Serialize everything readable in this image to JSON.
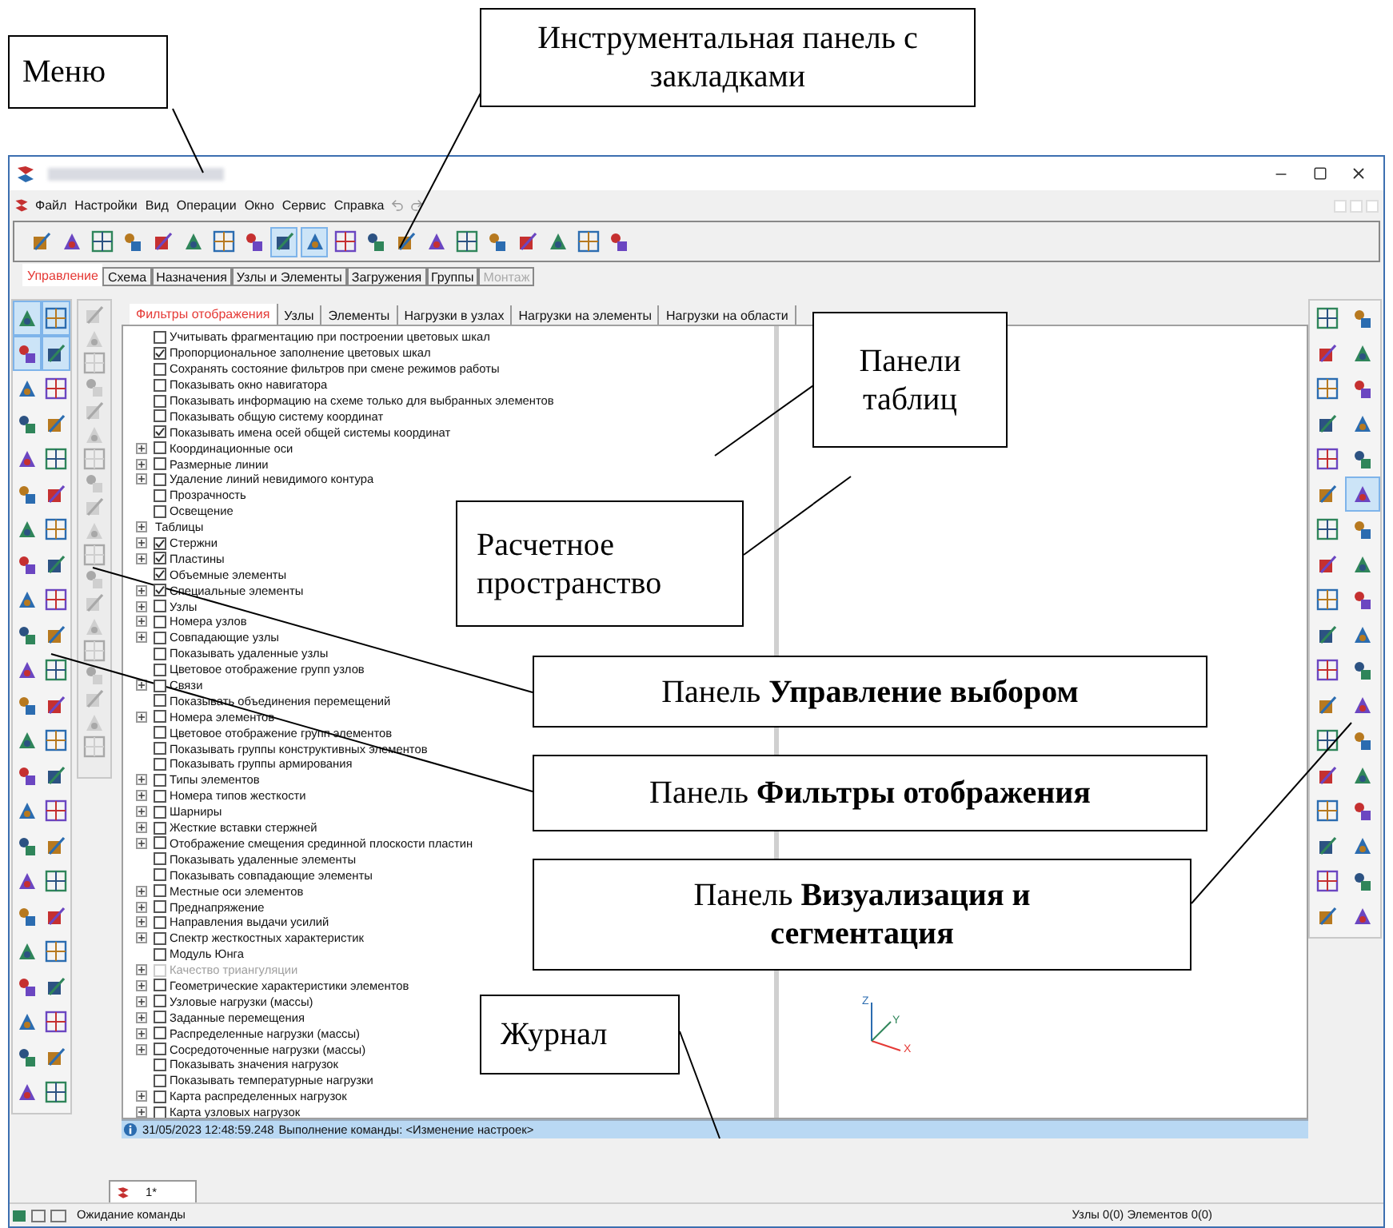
{
  "menu_bar": {
    "items": [
      "Файл",
      "Настройки",
      "Вид",
      "Операции",
      "Окно",
      "Сервис",
      "Справка"
    ]
  },
  "toolbar": {
    "buttons": [
      {
        "selected": false
      },
      {
        "selected": false
      },
      {
        "selected": false
      },
      {
        "selected": false
      },
      {
        "selected": false
      },
      {
        "selected": false
      },
      {
        "selected": false
      },
      {
        "selected": false
      },
      {
        "selected": true
      },
      {
        "selected": true
      },
      {
        "selected": false
      },
      {
        "selected": false
      },
      {
        "selected": false
      },
      {
        "selected": false
      },
      {
        "selected": false
      },
      {
        "selected": false
      },
      {
        "selected": false
      },
      {
        "selected": false
      },
      {
        "selected": false
      },
      {
        "selected": false
      }
    ]
  },
  "toolbar_tabs": [
    {
      "label": "Управление",
      "selected": true,
      "disabled": false
    },
    {
      "label": "Схема",
      "selected": false,
      "disabled": false
    },
    {
      "label": "Назначения",
      "selected": false,
      "disabled": false
    },
    {
      "label": "Узлы и Элементы",
      "selected": false,
      "disabled": false
    },
    {
      "label": "Загружения",
      "selected": false,
      "disabled": false
    },
    {
      "label": "Группы",
      "selected": false,
      "disabled": false
    },
    {
      "label": "Монтаж",
      "selected": false,
      "disabled": true
    }
  ],
  "left_toolbar": {
    "buttons": [
      {
        "selected": true
      },
      {
        "selected": true
      },
      {
        "selected": true
      },
      {
        "selected": true
      },
      {
        "selected": false
      },
      {
        "selected": false
      },
      {
        "selected": false
      },
      {
        "selected": false
      },
      {
        "selected": false
      },
      {
        "selected": false
      },
      {
        "selected": false
      },
      {
        "selected": false
      },
      {
        "selected": false
      },
      {
        "selected": false
      },
      {
        "selected": false
      },
      {
        "selected": false
      },
      {
        "selected": false
      },
      {
        "selected": false
      },
      {
        "selected": false
      },
      {
        "selected": false
      },
      {
        "selected": false
      },
      {
        "selected": false
      },
      {
        "selected": false
      },
      {
        "selected": false
      },
      {
        "selected": false
      },
      {
        "selected": false
      },
      {
        "selected": false
      },
      {
        "selected": false
      },
      {
        "selected": false
      },
      {
        "selected": false
      },
      {
        "selected": false
      },
      {
        "selected": false
      },
      {
        "selected": false
      },
      {
        "selected": false
      },
      {
        "selected": false
      },
      {
        "selected": false
      },
      {
        "selected": false
      },
      {
        "selected": false
      },
      {
        "selected": false
      },
      {
        "selected": false
      },
      {
        "selected": false
      },
      {
        "selected": false
      },
      {
        "selected": false
      },
      {
        "selected": false
      },
      {
        "selected": false
      },
      {
        "selected": false
      }
    ]
  },
  "right_toolbar": {
    "buttons": [
      {
        "selected": false
      },
      {
        "selected": false
      },
      {
        "selected": false
      },
      {
        "selected": false
      },
      {
        "selected": false
      },
      {
        "selected": false
      },
      {
        "selected": false
      },
      {
        "selected": false
      },
      {
        "selected": false
      },
      {
        "selected": false
      },
      {
        "selected": false
      },
      {
        "selected": true
      },
      {
        "selected": false
      },
      {
        "selected": false
      },
      {
        "selected": false
      },
      {
        "selected": false
      },
      {
        "selected": false
      },
      {
        "selected": false
      },
      {
        "selected": false
      },
      {
        "selected": false
      },
      {
        "selected": false
      },
      {
        "selected": false
      },
      {
        "selected": false
      },
      {
        "selected": false
      },
      {
        "selected": false
      },
      {
        "selected": false
      },
      {
        "selected": false
      },
      {
        "selected": false
      },
      {
        "selected": false
      },
      {
        "selected": false
      },
      {
        "selected": false
      },
      {
        "selected": false
      },
      {
        "selected": false
      },
      {
        "selected": false
      },
      {
        "selected": false
      },
      {
        "selected": false
      }
    ]
  },
  "panel_tabs": [
    {
      "label": "Фильтры отображения",
      "selected": true
    },
    {
      "label": "Узлы",
      "selected": false
    },
    {
      "label": "Элементы",
      "selected": false
    },
    {
      "label": "Нагрузки в узлах",
      "selected": false
    },
    {
      "label": "Нагрузки на элементы",
      "selected": false
    },
    {
      "label": "Нагрузки на области",
      "selected": false
    }
  ],
  "filters": [
    {
      "kind": "option",
      "label": "Учитывать фрагментацию при построении цветовых шкал",
      "checked": false,
      "disabled": false
    },
    {
      "kind": "option",
      "label": "Пропорциональное заполнение цветовых шкал",
      "checked": true,
      "disabled": false
    },
    {
      "kind": "option",
      "label": "Сохранять состояние фильтров при смене режимов работы",
      "checked": false,
      "disabled": false
    },
    {
      "kind": "option",
      "label": "Показывать окно навигатора",
      "checked": false,
      "disabled": false
    },
    {
      "kind": "option",
      "label": "Показывать информацию на схеме только для выбранных элементов",
      "checked": false,
      "disabled": false
    },
    {
      "kind": "option",
      "label": "Показывать общую систему координат",
      "checked": false,
      "disabled": false
    },
    {
      "kind": "option",
      "label": "Показывать имена осей общей системы координат",
      "checked": true,
      "disabled": false
    },
    {
      "kind": "group",
      "label": "Координационные оси",
      "checked": false,
      "expanded": false,
      "disabled": false
    },
    {
      "kind": "group",
      "label": "Размерные линии",
      "checked": false,
      "expanded": false,
      "disabled": false
    },
    {
      "kind": "group",
      "label": "Удаление линий невидимого контура",
      "checked": false,
      "expanded": false,
      "disabled": false
    },
    {
      "kind": "option",
      "label": "Прозрачность",
      "checked": false,
      "disabled": false
    },
    {
      "kind": "option",
      "label": "Освещение",
      "checked": false,
      "disabled": false
    },
    {
      "kind": "heading",
      "label": "Таблицы",
      "expanded": false,
      "disabled": false
    },
    {
      "kind": "group",
      "label": "Стержни",
      "checked": true,
      "expanded": false,
      "disabled": false
    },
    {
      "kind": "group",
      "label": "Пластины",
      "checked": true,
      "expanded": false,
      "disabled": false
    },
    {
      "kind": "option",
      "label": "Объемные элементы",
      "checked": true,
      "disabled": false
    },
    {
      "kind": "group",
      "label": "Специальные элементы",
      "checked": true,
      "expanded": false,
      "disabled": false
    },
    {
      "kind": "group",
      "label": "Узлы",
      "checked": false,
      "expanded": false,
      "disabled": false
    },
    {
      "kind": "group",
      "label": "Номера узлов",
      "checked": false,
      "expanded": false,
      "disabled": false
    },
    {
      "kind": "group",
      "label": "Совпадающие узлы",
      "checked": false,
      "expanded": false,
      "disabled": false
    },
    {
      "kind": "option",
      "label": "Показывать удаленные узлы",
      "checked": false,
      "disabled": false
    },
    {
      "kind": "option",
      "label": "Цветовое отображение групп узлов",
      "checked": false,
      "disabled": false
    },
    {
      "kind": "group",
      "label": "Связи",
      "checked": false,
      "expanded": false,
      "disabled": false
    },
    {
      "kind": "option",
      "label": "Показывать объединения перемещений",
      "checked": false,
      "disabled": false
    },
    {
      "kind": "group",
      "label": "Номера элементов",
      "checked": false,
      "expanded": false,
      "disabled": false
    },
    {
      "kind": "option",
      "label": "Цветовое отображение групп элементов",
      "checked": false,
      "disabled": false
    },
    {
      "kind": "option",
      "label": "Показывать группы конструктивных элементов",
      "checked": false,
      "disabled": false
    },
    {
      "kind": "option",
      "label": "Показывать группы армирования",
      "checked": false,
      "disabled": false
    },
    {
      "kind": "group",
      "label": "Типы элементов",
      "checked": false,
      "expanded": false,
      "disabled": false
    },
    {
      "kind": "group",
      "label": "Номера типов жесткости",
      "checked": false,
      "expanded": false,
      "disabled": false
    },
    {
      "kind": "group",
      "label": "Шарниры",
      "checked": false,
      "expanded": false,
      "disabled": false
    },
    {
      "kind": "group",
      "label": "Жесткие вставки стержней",
      "checked": false,
      "expanded": false,
      "disabled": false
    },
    {
      "kind": "group",
      "label": "Отображение смещения срединной плоскости пластин",
      "checked": false,
      "expanded": false,
      "disabled": false
    },
    {
      "kind": "option",
      "label": "Показывать удаленные элементы",
      "checked": false,
      "disabled": false
    },
    {
      "kind": "option",
      "label": "Показывать совпадающие элементы",
      "checked": false,
      "disabled": false
    },
    {
      "kind": "group",
      "label": "Местные оси элементов",
      "checked": false,
      "expanded": false,
      "disabled": false
    },
    {
      "kind": "group",
      "label": "Преднапряжение",
      "checked": false,
      "expanded": false,
      "disabled": false
    },
    {
      "kind": "group",
      "label": "Направления выдачи усилий",
      "checked": false,
      "expanded": false,
      "disabled": false
    },
    {
      "kind": "group",
      "label": "Спектр жесткостных характеристик",
      "checked": false,
      "expanded": false,
      "disabled": false
    },
    {
      "kind": "option",
      "label": "Модуль Юнга",
      "checked": false,
      "disabled": false
    },
    {
      "kind": "group",
      "label": "Качество триангуляции",
      "checked": false,
      "expanded": false,
      "disabled": true
    },
    {
      "kind": "group",
      "label": "Геометрические характеристики элементов",
      "checked": false,
      "expanded": false,
      "disabled": false
    },
    {
      "kind": "group",
      "label": "Узловые нагрузки (массы)",
      "checked": false,
      "expanded": false,
      "disabled": false
    },
    {
      "kind": "group",
      "label": "Заданные перемещения",
      "checked": false,
      "expanded": false,
      "disabled": false
    },
    {
      "kind": "group",
      "label": "Распределенные нагрузки (массы)",
      "checked": false,
      "expanded": false,
      "disabled": false
    },
    {
      "kind": "group",
      "label": "Сосредоточенные нагрузки (массы)",
      "checked": false,
      "expanded": false,
      "disabled": false
    },
    {
      "kind": "option",
      "label": "Показывать значения нагрузок",
      "checked": false,
      "disabled": false
    },
    {
      "kind": "option",
      "label": "Показывать температурные нагрузки",
      "checked": false,
      "disabled": false
    },
    {
      "kind": "group",
      "label": "Карта распределенных нагрузок",
      "checked": false,
      "expanded": false,
      "disabled": false
    },
    {
      "kind": "group",
      "label": "Карта узловых нагрузок",
      "checked": false,
      "expanded": false,
      "disabled": false
    }
  ],
  "axes": {
    "x": "X",
    "y": "Y",
    "z": "Z"
  },
  "log": {
    "timestamp": "31/05/2023 12:48:59.248",
    "message": "Выполнение команды: <Изменение настроек>"
  },
  "document_tab": {
    "label": "1*"
  },
  "status_bar": {
    "state": "Ожидание команды",
    "counts": "Узлы 0(0) Элементов 0(0)"
  },
  "callouts": [
    {
      "text": "Меню"
    },
    {
      "text": "Инструментальная панель с закладками"
    },
    {
      "text": "Панели таблиц"
    },
    {
      "text": "Расчетное пространство"
    },
    {
      "text": "Панель **Управление выбором**"
    },
    {
      "text": "Панель **Фильтры отображения**"
    },
    {
      "text": "Панель **Визуализация и сегментация**"
    },
    {
      "text": "Журнал"
    }
  ]
}
